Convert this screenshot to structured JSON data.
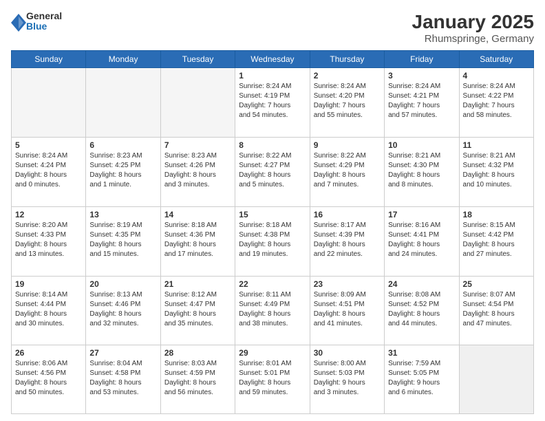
{
  "header": {
    "logo": {
      "line1": "General",
      "line2": "Blue"
    },
    "title": "January 2025",
    "subtitle": "Rhumspringe, Germany"
  },
  "days_of_week": [
    "Sunday",
    "Monday",
    "Tuesday",
    "Wednesday",
    "Thursday",
    "Friday",
    "Saturday"
  ],
  "weeks": [
    [
      {
        "day": "",
        "info": ""
      },
      {
        "day": "",
        "info": ""
      },
      {
        "day": "",
        "info": ""
      },
      {
        "day": "1",
        "info": "Sunrise: 8:24 AM\nSunset: 4:19 PM\nDaylight: 7 hours\nand 54 minutes."
      },
      {
        "day": "2",
        "info": "Sunrise: 8:24 AM\nSunset: 4:20 PM\nDaylight: 7 hours\nand 55 minutes."
      },
      {
        "day": "3",
        "info": "Sunrise: 8:24 AM\nSunset: 4:21 PM\nDaylight: 7 hours\nand 57 minutes."
      },
      {
        "day": "4",
        "info": "Sunrise: 8:24 AM\nSunset: 4:22 PM\nDaylight: 7 hours\nand 58 minutes."
      }
    ],
    [
      {
        "day": "5",
        "info": "Sunrise: 8:24 AM\nSunset: 4:24 PM\nDaylight: 8 hours\nand 0 minutes."
      },
      {
        "day": "6",
        "info": "Sunrise: 8:23 AM\nSunset: 4:25 PM\nDaylight: 8 hours\nand 1 minute."
      },
      {
        "day": "7",
        "info": "Sunrise: 8:23 AM\nSunset: 4:26 PM\nDaylight: 8 hours\nand 3 minutes."
      },
      {
        "day": "8",
        "info": "Sunrise: 8:22 AM\nSunset: 4:27 PM\nDaylight: 8 hours\nand 5 minutes."
      },
      {
        "day": "9",
        "info": "Sunrise: 8:22 AM\nSunset: 4:29 PM\nDaylight: 8 hours\nand 7 minutes."
      },
      {
        "day": "10",
        "info": "Sunrise: 8:21 AM\nSunset: 4:30 PM\nDaylight: 8 hours\nand 8 minutes."
      },
      {
        "day": "11",
        "info": "Sunrise: 8:21 AM\nSunset: 4:32 PM\nDaylight: 8 hours\nand 10 minutes."
      }
    ],
    [
      {
        "day": "12",
        "info": "Sunrise: 8:20 AM\nSunset: 4:33 PM\nDaylight: 8 hours\nand 13 minutes."
      },
      {
        "day": "13",
        "info": "Sunrise: 8:19 AM\nSunset: 4:35 PM\nDaylight: 8 hours\nand 15 minutes."
      },
      {
        "day": "14",
        "info": "Sunrise: 8:18 AM\nSunset: 4:36 PM\nDaylight: 8 hours\nand 17 minutes."
      },
      {
        "day": "15",
        "info": "Sunrise: 8:18 AM\nSunset: 4:38 PM\nDaylight: 8 hours\nand 19 minutes."
      },
      {
        "day": "16",
        "info": "Sunrise: 8:17 AM\nSunset: 4:39 PM\nDaylight: 8 hours\nand 22 minutes."
      },
      {
        "day": "17",
        "info": "Sunrise: 8:16 AM\nSunset: 4:41 PM\nDaylight: 8 hours\nand 24 minutes."
      },
      {
        "day": "18",
        "info": "Sunrise: 8:15 AM\nSunset: 4:42 PM\nDaylight: 8 hours\nand 27 minutes."
      }
    ],
    [
      {
        "day": "19",
        "info": "Sunrise: 8:14 AM\nSunset: 4:44 PM\nDaylight: 8 hours\nand 30 minutes."
      },
      {
        "day": "20",
        "info": "Sunrise: 8:13 AM\nSunset: 4:46 PM\nDaylight: 8 hours\nand 32 minutes."
      },
      {
        "day": "21",
        "info": "Sunrise: 8:12 AM\nSunset: 4:47 PM\nDaylight: 8 hours\nand 35 minutes."
      },
      {
        "day": "22",
        "info": "Sunrise: 8:11 AM\nSunset: 4:49 PM\nDaylight: 8 hours\nand 38 minutes."
      },
      {
        "day": "23",
        "info": "Sunrise: 8:09 AM\nSunset: 4:51 PM\nDaylight: 8 hours\nand 41 minutes."
      },
      {
        "day": "24",
        "info": "Sunrise: 8:08 AM\nSunset: 4:52 PM\nDaylight: 8 hours\nand 44 minutes."
      },
      {
        "day": "25",
        "info": "Sunrise: 8:07 AM\nSunset: 4:54 PM\nDaylight: 8 hours\nand 47 minutes."
      }
    ],
    [
      {
        "day": "26",
        "info": "Sunrise: 8:06 AM\nSunset: 4:56 PM\nDaylight: 8 hours\nand 50 minutes."
      },
      {
        "day": "27",
        "info": "Sunrise: 8:04 AM\nSunset: 4:58 PM\nDaylight: 8 hours\nand 53 minutes."
      },
      {
        "day": "28",
        "info": "Sunrise: 8:03 AM\nSunset: 4:59 PM\nDaylight: 8 hours\nand 56 minutes."
      },
      {
        "day": "29",
        "info": "Sunrise: 8:01 AM\nSunset: 5:01 PM\nDaylight: 8 hours\nand 59 minutes."
      },
      {
        "day": "30",
        "info": "Sunrise: 8:00 AM\nSunset: 5:03 PM\nDaylight: 9 hours\nand 3 minutes."
      },
      {
        "day": "31",
        "info": "Sunrise: 7:59 AM\nSunset: 5:05 PM\nDaylight: 9 hours\nand 6 minutes."
      },
      {
        "day": "",
        "info": ""
      }
    ]
  ]
}
